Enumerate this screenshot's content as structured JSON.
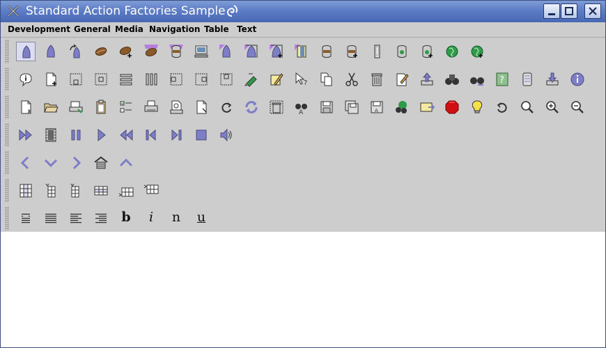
{
  "window": {
    "title": "Standard Action Factories Sample"
  },
  "menu": [
    "Development",
    "General",
    "Media",
    "Navigation",
    "Table",
    "Text"
  ],
  "colors": {
    "titlebar": "#5d7dc6",
    "panel": "#cdcdcd",
    "icon_purple": "#7e7ec8",
    "icon_brown": "#8b5a2b",
    "globe": "#2f9a4a"
  },
  "toolbars": [
    {
      "name": "development",
      "icons": [
        "applet-icon",
        "application-icon",
        "redeploy-icon",
        "bean-icon",
        "add-bean-icon",
        "enterprise-bean-icon",
        "enterprise-data-icon",
        "host-icon",
        "j2ee-application-icon",
        "j2ee-client-icon",
        "j2ee-server-icon",
        "jar-icon",
        "jdbc-data-source-icon",
        "jms-resource-icon",
        "war-icon",
        "jsp-resource-icon",
        "jsp-add-icon",
        "web-component-icon",
        "web-component-add-icon"
      ]
    },
    {
      "name": "general",
      "icons": [
        "about-icon",
        "new-icon",
        "align-bottom-icon",
        "align-center-icon",
        "align-justify-horizontal-icon",
        "align-justify-vertical-icon",
        "align-left-icon",
        "align-right-icon",
        "align-top-icon",
        "bookmarks-icon",
        "edit-icon",
        "context-help-icon",
        "copy-icon",
        "cut-icon",
        "delete-icon",
        "compose-icon",
        "export-icon",
        "find-icon",
        "find-again-icon",
        "help-icon",
        "history-icon",
        "import-icon",
        "information-icon"
      ]
    },
    {
      "name": "general-2",
      "icons": [
        "new-document-icon",
        "open-icon",
        "page-setup-icon",
        "paste-icon",
        "preferences-icon",
        "print-icon",
        "print-preview-icon",
        "properties-icon",
        "redo-icon",
        "refresh-icon",
        "remove-icon",
        "replace-icon",
        "save-icon",
        "save-all-icon",
        "save-as-icon",
        "search-icon",
        "send-mail-icon",
        "stop-icon",
        "tip-icon",
        "undo-icon",
        "zoom-icon",
        "zoom-in-icon",
        "zoom-out-icon"
      ]
    },
    {
      "name": "media",
      "icons": [
        "fast-forward-icon",
        "movie-icon",
        "pause-icon",
        "play-icon",
        "rewind-icon",
        "step-back-icon",
        "step-forward-icon",
        "stop-media-icon",
        "volume-icon"
      ]
    },
    {
      "name": "navigation",
      "icons": [
        "back-icon",
        "down-icon",
        "forward-icon",
        "home-icon",
        "up-icon"
      ]
    },
    {
      "name": "table",
      "icons": [
        "column-delete-icon",
        "column-insert-after-icon",
        "column-insert-before-icon",
        "row-delete-icon",
        "row-insert-after-icon",
        "row-insert-before-icon"
      ]
    },
    {
      "name": "text",
      "icons": [
        "align-center-text-icon",
        "align-justify-text-icon",
        "align-left-text-icon",
        "align-right-text-icon",
        "bold-icon",
        "italic-icon",
        "normal-icon",
        "underline-icon"
      ]
    }
  ],
  "text_toolbar_labels": {
    "bold": "b",
    "italic": "i",
    "normal": "n",
    "underline": "u"
  }
}
